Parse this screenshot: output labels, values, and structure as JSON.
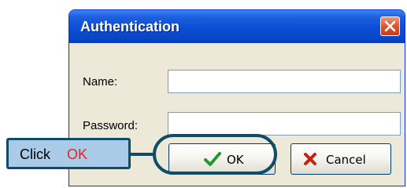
{
  "dialog": {
    "title": "Authentication",
    "name_label": "Name:",
    "name_value": "",
    "password_label": "Password:",
    "password_value": "",
    "ok_label": "OK",
    "cancel_label": "Cancel"
  },
  "annotation": {
    "prefix": "Click",
    "highlight": "OK",
    "highlight_color": "#e8231c",
    "frame_color": "#0e4c68"
  },
  "icons": {
    "close": "close-icon",
    "ok": "checkmark-icon",
    "cancel": "x-icon"
  }
}
